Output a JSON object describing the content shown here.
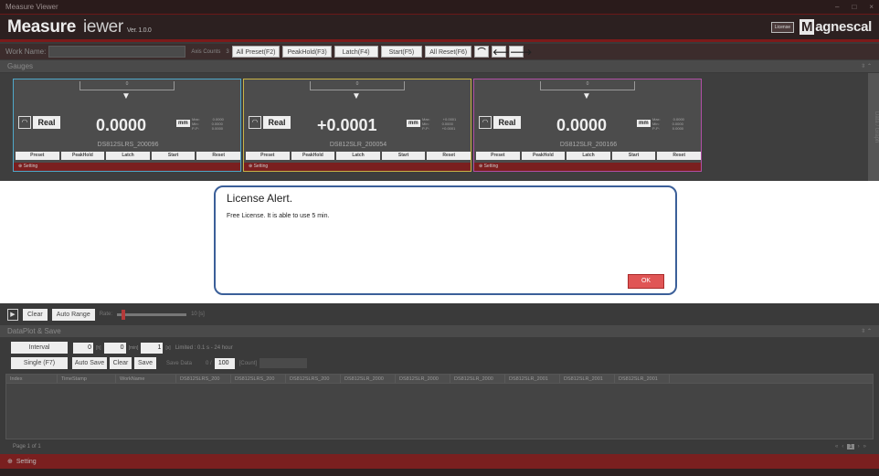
{
  "window": {
    "title": "Measure Viewer",
    "controls": [
      "–",
      "□",
      "×"
    ]
  },
  "header": {
    "brand_bold": "Measure",
    "brand_thin": "iewer",
    "version": "Ver. 1.0.0",
    "license_label": "License",
    "logo_m": "M",
    "logo_rest": "agnescal"
  },
  "toolbar": {
    "work_name_label": "Work Name:",
    "axis_counts_label": "Axis Counts",
    "axis_counts_value": "3",
    "buttons": [
      "All Preset(F2)",
      "PeakHold(F3)",
      "Latch(F4)",
      "Start(F5)",
      "All Reset(F6)"
    ],
    "icon_buttons": [
      "⌒",
      "🡐",
      "🡒"
    ]
  },
  "gauges_section": {
    "title": "Gauges",
    "controls": "⇳ ⌃",
    "side_tab": "Data / Graph"
  },
  "gauges": [
    {
      "top_value": "0",
      "mode": "Real",
      "value": "0.0000",
      "unit": "mm",
      "max_label": "Max:",
      "min_label": "Min:",
      "pp_label": "P-P:",
      "max": "0.0000",
      "min": "0.0000",
      "pp": "0.0000",
      "name": "DS812SLRS_200096",
      "buttons": [
        "Preset",
        "PeakHold",
        "Latch",
        "Start",
        "Reset"
      ],
      "setting": "Setting",
      "color": "#4fa8c9"
    },
    {
      "top_value": "0",
      "mode": "Real",
      "value": "+0.0001",
      "unit": "mm",
      "max_label": "Max:",
      "min_label": "Min:",
      "pp_label": "P-P:",
      "max": "+0.0001",
      "min": "0.0000",
      "pp": "+0.0001",
      "name": "DS812SLR_200054",
      "buttons": [
        "Preset",
        "PeakHold",
        "Latch",
        "Start",
        "Reset"
      ],
      "setting": "Setting",
      "color": "#c9b347"
    },
    {
      "top_value": "0",
      "mode": "Real",
      "value": "0.0000",
      "unit": "mm",
      "max_label": "Max:",
      "min_label": "Min:",
      "pp_label": "P-P:",
      "max": "0.0000",
      "min": "0.0000",
      "pp": "0.0000",
      "name": "DS812SLR_200166",
      "buttons": [
        "Preset",
        "PeakHold",
        "Latch",
        "Start",
        "Reset"
      ],
      "setting": "Setting",
      "color": "#b04fa5"
    }
  ],
  "modal": {
    "title": "License Alert.",
    "message": "Free License.  It is able to use 5 min.",
    "ok_label": "OK"
  },
  "graph": {
    "clear_label": "Clear",
    "auto_range_label": "Auto Range",
    "rate_label": "Rate:",
    "slider_value": "10  [s]"
  },
  "dataplot": {
    "title": "DataPlot & Save",
    "controls": "⇳ ⌃",
    "interval_label": "Interval",
    "interval_h": "0",
    "interval_h_unit": "[h]",
    "interval_m": "0",
    "interval_m_unit": "[min]",
    "interval_s": "1",
    "interval_s_unit": "[s]",
    "limited": "Limited : 0.1 s - 24 hour",
    "single_label": "Single (F7)",
    "autosave_label": "Auto Save",
    "clear_label": "Clear",
    "save_label": "Save",
    "save_data_label": "Save Data",
    "save_data_value": "0 /",
    "save_count": "100",
    "count_label": "[Count]",
    "columns": [
      "Index",
      "TimeStamp",
      "WorkName",
      "DS812SLRS_200",
      "DS812SLRS_200",
      "DS812SLRS_200",
      "DS812SLR_2000",
      "DS812SLR_2000",
      "DS812SLR_2000",
      "DS812SLR_2001",
      "DS812SLR_2001",
      "DS812SLR_2001"
    ],
    "page_text": "Page 1 of 1",
    "pager": [
      "«",
      "‹",
      "1",
      "›",
      "»"
    ]
  },
  "footer": {
    "setting_label": "Setting"
  }
}
